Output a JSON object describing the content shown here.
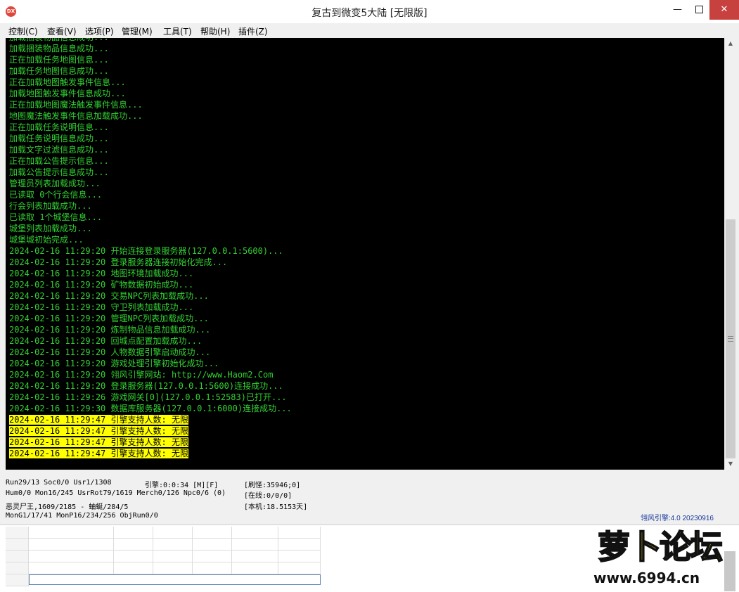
{
  "window": {
    "title": "复古到微变5大陆 [无限版]",
    "icon_text": "DX",
    "controls": {
      "minimize": "—",
      "close": "✕"
    }
  },
  "menu": [
    "控制(C)",
    "查看(V)",
    "选项(P)",
    "管理(M)",
    "工具(T)",
    "帮助(H)",
    "插件(Z)"
  ],
  "console": {
    "lines": [
      {
        "text": "加载捆装物品信息成功...",
        "highlight": false
      },
      {
        "text": "加载捆装物品信息成功...",
        "highlight": false
      },
      {
        "text": "正在加载任务地图信息...",
        "highlight": false
      },
      {
        "text": "加载任务地图信息成功...",
        "highlight": false
      },
      {
        "text": "正在加载地图触发事件信息...",
        "highlight": false
      },
      {
        "text": "加载地图触发事件信息成功...",
        "highlight": false
      },
      {
        "text": "正在加载地图魔法触发事件信息...",
        "highlight": false
      },
      {
        "text": "地图魔法触发事件信息加载成功...",
        "highlight": false
      },
      {
        "text": "正在加载任务说明信息...",
        "highlight": false
      },
      {
        "text": "加载任务说明信息成功...",
        "highlight": false
      },
      {
        "text": "加载文字过滤信息成功...",
        "highlight": false
      },
      {
        "text": "正在加载公告提示信息...",
        "highlight": false
      },
      {
        "text": "加载公告提示信息成功...",
        "highlight": false
      },
      {
        "text": "管理员列表加载成功...",
        "highlight": false
      },
      {
        "text": "已读取 0个行会信息...",
        "highlight": false
      },
      {
        "text": "行会列表加载成功...",
        "highlight": false
      },
      {
        "text": "已读取 1个城堡信息...",
        "highlight": false
      },
      {
        "text": "城堡列表加载成功...",
        "highlight": false
      },
      {
        "text": "城堡城初始完成...",
        "highlight": false
      },
      {
        "text": "2024-02-16 11:29:20 开始连接登录服务器(127.0.0.1:5600)...",
        "highlight": false
      },
      {
        "text": "2024-02-16 11:29:20 登录服务器连接初始化完成...",
        "highlight": false
      },
      {
        "text": "2024-02-16 11:29:20 地图环境加载成功...",
        "highlight": false
      },
      {
        "text": "2024-02-16 11:29:20 矿物数据初始成功...",
        "highlight": false
      },
      {
        "text": "2024-02-16 11:29:20 交易NPC列表加载成功...",
        "highlight": false
      },
      {
        "text": "2024-02-16 11:29:20 守卫列表加载成功...",
        "highlight": false
      },
      {
        "text": "2024-02-16 11:29:20 管理NPC列表加载成功...",
        "highlight": false
      },
      {
        "text": "2024-02-16 11:29:20 炼制物品信息加载成功...",
        "highlight": false
      },
      {
        "text": "2024-02-16 11:29:20 回城点配置加载成功...",
        "highlight": false
      },
      {
        "text": "2024-02-16 11:29:20 人物数据引擎启动成功...",
        "highlight": false
      },
      {
        "text": "2024-02-16 11:29:20 游戏处理引擎初始化成功...",
        "highlight": false
      },
      {
        "text": "2024-02-16 11:29:20 翎风引擎网站: http://www.Haom2.Com",
        "highlight": false
      },
      {
        "text": "2024-02-16 11:29:20 登录服务器(127.0.0.1:5600)连接成功...",
        "highlight": false
      },
      {
        "text": "2024-02-16 11:29:26 游戏网关[0](127.0.0.1:52583)已打开...",
        "highlight": false
      },
      {
        "text": "2024-02-16 11:29:30 数据库服务器(127.0.0.1:6000)连接成功...",
        "highlight": false
      },
      {
        "text": "2024-02-16 11:29:47 引擎支持人数: 无限",
        "highlight": true
      },
      {
        "text": "2024-02-16 11:29:47 引擎支持人数: 无限",
        "highlight": true
      },
      {
        "text": "2024-02-16 11:29:47 引擎支持人数: 无限",
        "highlight": true
      },
      {
        "text": "2024-02-16 11:29:47 引擎支持人数: 无限",
        "highlight": true
      }
    ]
  },
  "status": {
    "run": "Run29/13 Soc0/0 Usr1/1308",
    "engine_time": "引擎:0:0:34 [M][F]",
    "refresh_monster": "[刷怪:35946;0]",
    "hum": "Hum0/0 Mon16/245 UsrRot79/1619 Merch0/126 Npc0/6 (0)",
    "online": "[在线:0/0/0]",
    "monster": "恶灵尸王,1609/2185 - 蚰蜒/284/5",
    "uptime": "[本机:18.5153天]",
    "mon_group": "MonG1/17/41 MonP16/234/256 ObjRun0/0",
    "engine_version": "翎风引擎:4.0 20230916"
  },
  "watermark": {
    "brand": "萝卜论坛",
    "url": "www.6994.cn"
  },
  "colors": {
    "console_bg": "#000000",
    "console_text": "#32d232",
    "highlight_bg": "#ffff00",
    "close_button": "#c7413f"
  }
}
